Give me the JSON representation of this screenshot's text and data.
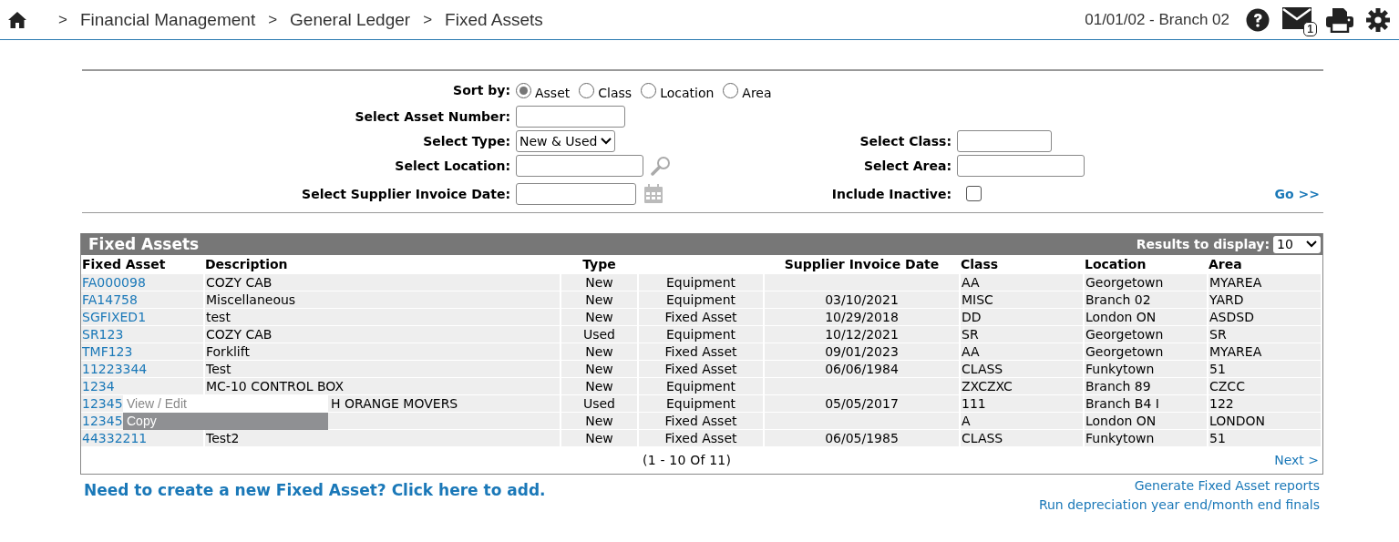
{
  "header": {
    "breadcrumb": [
      {
        "separator": ">",
        "label": "Financial Management"
      },
      {
        "separator": ">",
        "label": "General Ledger"
      },
      {
        "separator": ">",
        "label": "Fixed Assets"
      }
    ],
    "session": "01/01/02 - Branch 02",
    "messages_badge": "1"
  },
  "form": {
    "sort": {
      "label": "Sort by:",
      "options": [
        {
          "label": "Asset",
          "selected": true
        },
        {
          "label": "Class",
          "selected": false
        },
        {
          "label": "Location",
          "selected": false
        },
        {
          "label": "Area",
          "selected": false
        }
      ]
    },
    "rows": [
      {
        "left": {
          "kind": "text",
          "label": "Select Asset Number:"
        }
      },
      {
        "left": {
          "kind": "select",
          "label": "Select Type:",
          "value": "New & Used"
        },
        "right": {
          "kind": "text",
          "label": "Select Class:"
        }
      },
      {
        "left": {
          "kind": "lookup",
          "label": "Select Location:"
        },
        "right": {
          "kind": "text",
          "label": "Select Area:"
        }
      },
      {
        "left": {
          "kind": "date",
          "label": "Select Supplier Invoice Date:"
        },
        "right": {
          "kind": "checkbox",
          "label": "Include Inactive:",
          "checked": false
        },
        "action": "Go >>"
      }
    ]
  },
  "table": {
    "title": "Fixed Assets",
    "results_label": "Results to display:",
    "results_value": "10",
    "columns": [
      {
        "kind": "text",
        "label": "Fixed Asset"
      },
      {
        "kind": "text",
        "label": "Description"
      },
      {
        "kind": "text",
        "label": "Type"
      },
      {
        "kind": "blank"
      },
      {
        "kind": "text",
        "label": "Supplier Invoice Date"
      },
      {
        "kind": "text",
        "label": "Class"
      },
      {
        "kind": "text",
        "label": "Location"
      },
      {
        "kind": "text",
        "label": "Area"
      }
    ],
    "rows": [
      {
        "fixed_asset": "FA000098",
        "description": "COZY CAB",
        "type": "New",
        "column_4": "Equipment",
        "class": "AA",
        "location": "Georgetown",
        "area": "MYAREA"
      },
      {
        "fixed_asset": "FA14758",
        "description": "Miscellaneous",
        "type": "New",
        "column_4": "Equipment",
        "supplier_invoice_date": "03/10/2021",
        "class": "MISC",
        "location": "Branch 02",
        "area": "YARD"
      },
      {
        "fixed_asset": "SGFIXED1",
        "description": "test",
        "type": "New",
        "column_4": "Fixed Asset",
        "supplier_invoice_date": "10/29/2018",
        "class": "DD",
        "location": "London ON",
        "area": "ASDSD"
      },
      {
        "fixed_asset": "SR123",
        "description": "COZY CAB",
        "type": "Used",
        "column_4": "Equipment",
        "supplier_invoice_date": "10/12/2021",
        "class": "SR",
        "location": "Georgetown",
        "area": "SR"
      },
      {
        "fixed_asset": "TMF123",
        "description": "Forklift",
        "type": "New",
        "column_4": "Fixed Asset",
        "supplier_invoice_date": "09/01/2023",
        "class": "AA",
        "location": "Georgetown",
        "area": "MYAREA"
      },
      {
        "fixed_asset": "11223344",
        "description": "Test",
        "type": "New",
        "column_4": "Fixed Asset",
        "supplier_invoice_date": "06/06/1984",
        "class": "CLASS",
        "location": "Funkytown",
        "area": "51"
      },
      {
        "fixed_asset": "1234",
        "description": "MC-10 CONTROL BOX",
        "type": "New",
        "column_4": "Equipment",
        "class": "ZXCZXC",
        "location": "Branch 89",
        "area": "CZCC"
      },
      {
        "fixed_asset": "12345",
        "description": "H ORANGE MOVERS",
        "partly_covered": true,
        "type": "Used",
        "column_4": "Equipment",
        "supplier_invoice_date": "05/05/2017",
        "class": "111",
        "location": "Branch B4 I",
        "area": "122"
      },
      {
        "fixed_asset": "12345",
        "type": "New",
        "column_4": "Fixed Asset",
        "class": "A",
        "location": "London ON",
        "area": "LONDON"
      },
      {
        "fixed_asset": "44332211",
        "description": "Test2",
        "type": "New",
        "column_4": "Fixed Asset",
        "supplier_invoice_date": "06/05/1985",
        "class": "CLASS",
        "location": "Funkytown",
        "area": "51"
      }
    ],
    "pagination": "(1 - 10 Of 11)",
    "next": "Next >"
  },
  "context_menu": {
    "items": [
      {
        "label": "View / Edit",
        "selected": false
      },
      {
        "label": "Copy",
        "selected": true
      }
    ]
  },
  "footer": {
    "add_link": "Need to create a new Fixed Asset? Click here to add.",
    "links": [
      "Generate Fixed Asset reports",
      "Run depreciation year end/month end finals"
    ]
  }
}
